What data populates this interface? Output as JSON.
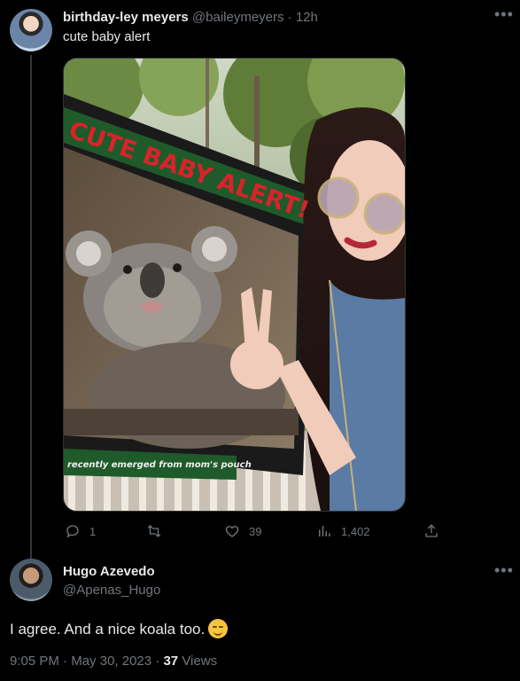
{
  "tweet": {
    "author_name": "birthday-ley meyers",
    "author_handle": "@baileymeyers",
    "separator": "·",
    "time": "12h",
    "text": "cute baby alert",
    "more_icon": "ellipsis-icon",
    "image": {
      "sign_headline": "CUTE BABY ALERT!",
      "sign_caption": "recently emerged from mom's pouch"
    },
    "actions": {
      "replies": "1",
      "retweets": "",
      "likes": "39",
      "views": "1,402"
    }
  },
  "reply": {
    "author_name": "Hugo Azevedo",
    "author_handle": "@Apenas_Hugo",
    "text": "I agree. And a nice koala too.",
    "emoji": "smirk-emoji",
    "time": "9:05 PM",
    "separator": "·",
    "date": "May 30, 2023",
    "views_count": "37",
    "views_label": "Views"
  },
  "colors": {
    "background": "#000000",
    "text": "#e7e9ea",
    "muted": "#71767b",
    "sign_green": "#1f5a2a",
    "sign_red": "#d8232a"
  }
}
